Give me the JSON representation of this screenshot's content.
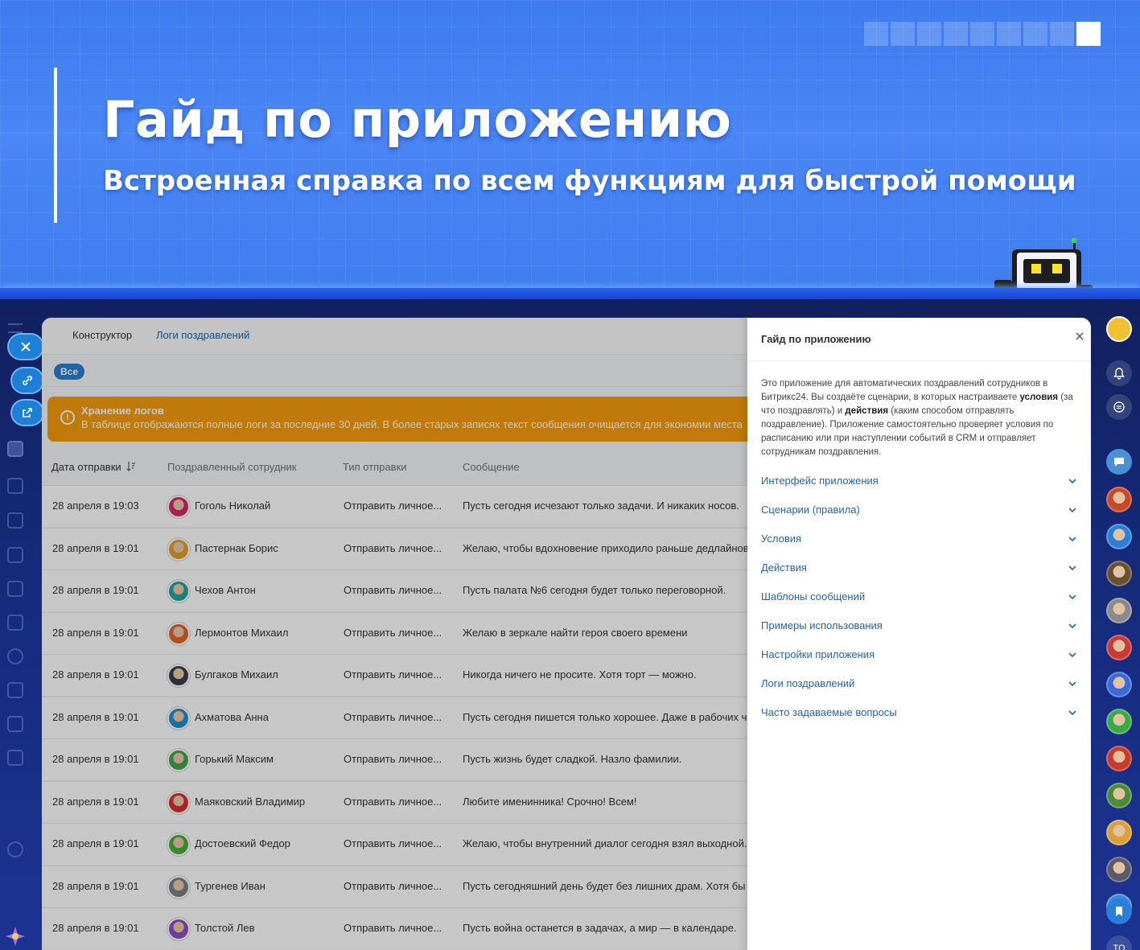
{
  "banner": {
    "title": "Гайд по приложению",
    "subtitle": "Встроенная справка по всем функциям для быстрой помощи",
    "pager_count": 9,
    "pager_active": 8
  },
  "tabs": [
    {
      "label": "Конструктор",
      "active": false
    },
    {
      "label": "Логи поздравлений",
      "active": true
    }
  ],
  "filter": {
    "chip": "Все"
  },
  "alert": {
    "title": "Хранение логов",
    "text": "В таблице отображаются полные логи за последние 30 дней. В более старых записях текст сообщения очищается для экономии места",
    "color": "#f59d0d"
  },
  "table": {
    "columns": [
      "Дата отправки",
      "Поздравленный сотрудник",
      "Тип отправки",
      "Сообщение"
    ],
    "rows": [
      {
        "date": "28 апреля в 19:03",
        "employee": "Гоголь Николай",
        "type": "Отправить личное...",
        "message": "Пусть сегодня исчезают только задачи. И никаких носов.",
        "avatar_color": "#d42a6e"
      },
      {
        "date": "28 апреля в 19:01",
        "employee": "Пастернак Борис",
        "type": "Отправить личное...",
        "message": "Желаю, чтобы вдохновение приходило раньше дедлайнов.",
        "avatar_color": "#e0a02a"
      },
      {
        "date": "28 апреля в 19:01",
        "employee": "Чехов Антон",
        "type": "Отправить личное...",
        "message": "Пусть палата №6 сегодня будет только переговорной.",
        "avatar_color": "#1fa6a0"
      },
      {
        "date": "28 апреля в 19:01",
        "employee": "Лермонтов Михаил",
        "type": "Отправить личное...",
        "message": "Желаю в зеркале найти героя своего времени",
        "avatar_color": "#e0652a"
      },
      {
        "date": "28 апреля в 19:01",
        "employee": "Булгаков Михаил",
        "type": "Отправить личное...",
        "message": "Никогда ничего не просите. Хотя торт — можно.",
        "avatar_color": "#3a3f4a"
      },
      {
        "date": "28 апреля в 19:01",
        "employee": "Ахматова Анна",
        "type": "Отправить личное...",
        "message": "Пусть сегодня пишется только хорошее. Даже в рабочих чатах.",
        "avatar_color": "#1f8fd0"
      },
      {
        "date": "28 апреля в 19:01",
        "employee": "Горький Максим",
        "type": "Отправить личное...",
        "message": "Пусть жизнь будет сладкой. Назло фамилии.",
        "avatar_color": "#3aa84a"
      },
      {
        "date": "28 апреля в 19:01",
        "employee": "Маяковский Владимир",
        "type": "Отправить личное...",
        "message": "Любите именинника! Срочно! Всем!",
        "avatar_color": "#d83030"
      },
      {
        "date": "28 апреля в 19:01",
        "employee": "Достоевский Федор",
        "type": "Отправить личное...",
        "message": "Желаю, чтобы внутренний диалог сегодня взял выходной.",
        "avatar_color": "#4cae3a"
      },
      {
        "date": "28 апреля в 19:01",
        "employee": "Тургенев Иван",
        "type": "Отправить личное...",
        "message": "Пусть сегодняшний день будет без лишних драм. Хотя бы до вечера.",
        "avatar_color": "#7a7f88"
      },
      {
        "date": "28 апреля в 19:01",
        "employee": "Толстой Лев",
        "type": "Отправить личное...",
        "message": "Пусть война останется в задачах, а мир — в календаре.",
        "avatar_color": "#8a4fc8"
      }
    ]
  },
  "guide": {
    "title": "Гайд по приложению",
    "intro_1": "Это приложение для автоматических поздравлений сотрудников в Битрикс24. Вы создаёте сценарии, в которых настраиваете ",
    "intro_b1": "условия",
    "intro_2": " (за что поздравлять) и ",
    "intro_b2": "действия",
    "intro_3": " (каким способом отправлять поздравление). Приложение самостоятельно проверяет условия по расписанию или при наступлении событий в CRM и отправляет сотрудникам поздравления.",
    "sections": [
      "Интерфейс приложения",
      "Сценарии (правила)",
      "Условия",
      "Действия",
      "Шаблоны сообщений",
      "Примеры использования",
      "Настройки приложения",
      "Логи поздравлений",
      "Часто задаваемые вопросы"
    ]
  },
  "right_rail": {
    "avatar_colors": [
      "#c8482a",
      "#2a7fd8",
      "#6a5030",
      "#8a8a8a",
      "#c83a3a",
      "#3a6ad8",
      "#3aa84a",
      "#c83a2a",
      "#4a8a3a",
      "#d8a03a",
      "#5a5a6a",
      "#3a8ad8"
    ],
    "bottom_label": "TO"
  }
}
